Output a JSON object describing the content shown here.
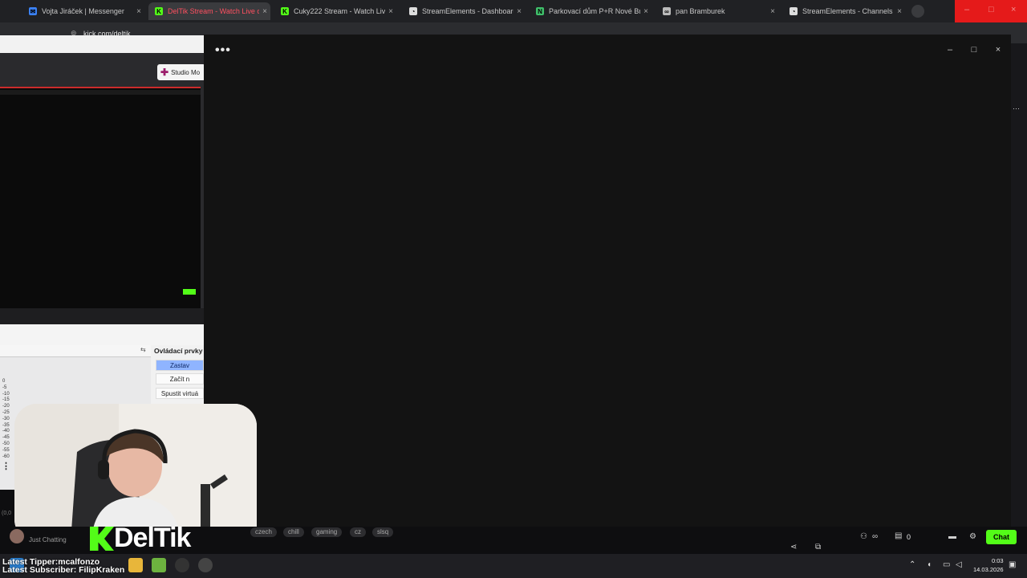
{
  "browser": {
    "tabs": [
      {
        "label": "Vojta Jiráček | Messenger",
        "favicon": "messenger-icon",
        "active": false
      },
      {
        "label": "DelTik Stream - Watch Live on",
        "favicon": "kick-icon",
        "active": true
      },
      {
        "label": "Cuky222 Stream - Watch Live o",
        "favicon": "kick-icon",
        "active": false
      },
      {
        "label": "StreamElements - Dashboard",
        "favicon": "streamelements-icon",
        "active": false
      },
      {
        "label": "Parkovací dům P+R Nové Buto",
        "favicon": "green-n-icon",
        "active": false
      },
      {
        "label": "pan Bramburek",
        "favicon": "link-icon",
        "active": false
      },
      {
        "label": "StreamElements - Channels",
        "favicon": "streamelements-icon",
        "active": false
      }
    ],
    "tab_close": "×",
    "address": "kick.com/deltik"
  },
  "obs": {
    "studio_mode_label": "Studio Mo",
    "controls_title": "Ovládací prvky",
    "controls": [
      "Zastav",
      "Začít n",
      "Spustit virtuá"
    ],
    "db_scale": [
      "0",
      "-5",
      "-10",
      "-15",
      "-20",
      "-25",
      "-30",
      "-35",
      "-40",
      "-45",
      "-50",
      "-55",
      "-60"
    ],
    "misc": "(0,0"
  },
  "overlay_window": {
    "menu_glyph": "•••",
    "minimize": "–",
    "maximize": "□",
    "close": "×"
  },
  "stream": {
    "category": "Just Chatting",
    "tags": [
      "czech",
      "chill",
      "gaming",
      "cz",
      "slsq"
    ],
    "logo_text": "DelTik",
    "viewer_count": "0",
    "chat_label": "Chat"
  },
  "overlay_ticker": {
    "latest_tipper": "Latest Tipper:mcalfonzo",
    "latest_subscriber": "Latest Subscriber: FilipKraken"
  },
  "taskbar": {
    "time": "0:03",
    "date": "14.03.2026"
  },
  "colors": {
    "kick_green": "#53fc18",
    "window_black": "#131313",
    "tab_active_text": "#ff5060"
  }
}
